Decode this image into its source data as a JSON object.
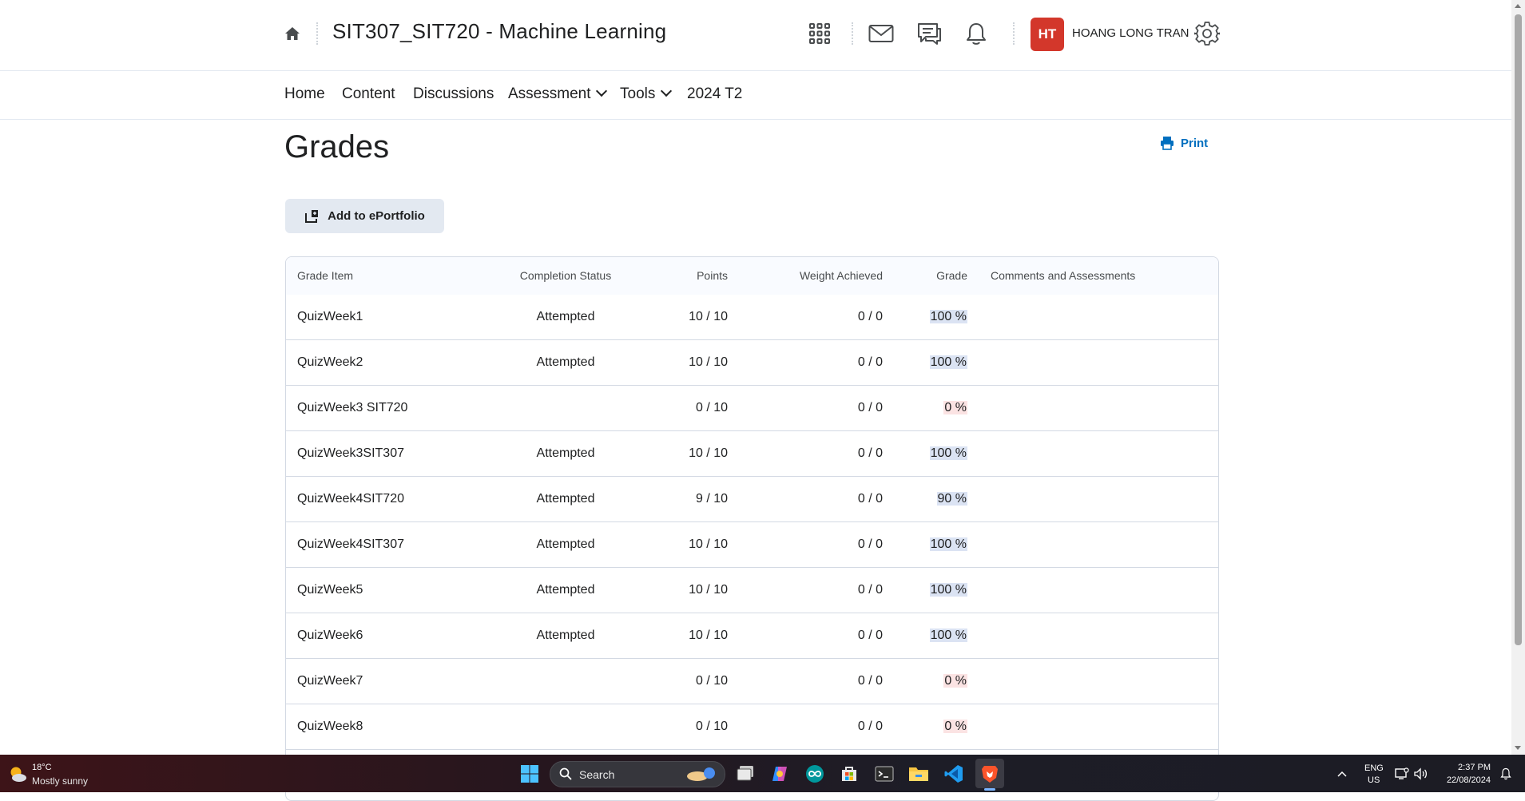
{
  "header": {
    "course_title": "SIT307_SIT720 - Machine Learning",
    "user_initials": "HT",
    "user_name": "HOANG LONG TRAN",
    "icons": [
      "home-icon",
      "app-grid-icon",
      "mail-icon",
      "chat-icon",
      "bell-icon",
      "gear-icon"
    ]
  },
  "nav": {
    "items": [
      {
        "label": "Home"
      },
      {
        "label": "Content"
      },
      {
        "label": "Discussions"
      },
      {
        "label": "Assessment"
      },
      {
        "label": "Tools"
      },
      {
        "label": "2024 T2"
      }
    ]
  },
  "page": {
    "title": "Grades",
    "print_label": "Print",
    "eportfolio_label": "Add to ePortfolio"
  },
  "table": {
    "headers": {
      "item": "Grade Item",
      "status": "Completion Status",
      "points": "Points",
      "weight": "Weight Achieved",
      "grade": "Grade",
      "comments": "Comments and Assessments"
    },
    "rows": [
      {
        "item": "QuizWeek1",
        "status": "Attempted",
        "points": "10 / 10",
        "weight": "0 / 0",
        "grade": "100 %"
      },
      {
        "item": "QuizWeek2",
        "status": "Attempted",
        "points": "10 / 10",
        "weight": "0 / 0",
        "grade": "100 %"
      },
      {
        "item": "QuizWeek3 SIT720",
        "status": "",
        "points": "0 / 10",
        "weight": "0 / 0",
        "grade": "0 %"
      },
      {
        "item": "QuizWeek3SIT307",
        "status": "Attempted",
        "points": "10 / 10",
        "weight": "0 / 0",
        "grade": "100 %"
      },
      {
        "item": "QuizWeek4SIT720",
        "status": "Attempted",
        "points": "9 / 10",
        "weight": "0 / 0",
        "grade": "90 %"
      },
      {
        "item": "QuizWeek4SIT307",
        "status": "Attempted",
        "points": "10 / 10",
        "weight": "0 / 0",
        "grade": "100 %"
      },
      {
        "item": "QuizWeek5",
        "status": "Attempted",
        "points": "10 / 10",
        "weight": "0 / 0",
        "grade": "100 %"
      },
      {
        "item": "QuizWeek6",
        "status": "Attempted",
        "points": "10 / 10",
        "weight": "0 / 0",
        "grade": "100 %"
      },
      {
        "item": "QuizWeek7",
        "status": "",
        "points": "0 / 10",
        "weight": "0 / 0",
        "grade": "0 %"
      },
      {
        "item": "QuizWeek8",
        "status": "",
        "points": "0 / 10",
        "weight": "0 / 0",
        "grade": "0 %"
      }
    ]
  },
  "taskbar": {
    "weather_temp": "18°C",
    "weather_desc": "Mostly sunny",
    "search_label": "Search",
    "lang_line1": "ENG",
    "lang_line2": "US",
    "time": "2:37 PM",
    "date": "22/08/2024"
  },
  "colors": {
    "accent": "#006fbf",
    "avatar_bg": "#d3372b",
    "grade_high_bg": "#dbe3f3",
    "grade_low_bg": "#fbe3e3"
  }
}
